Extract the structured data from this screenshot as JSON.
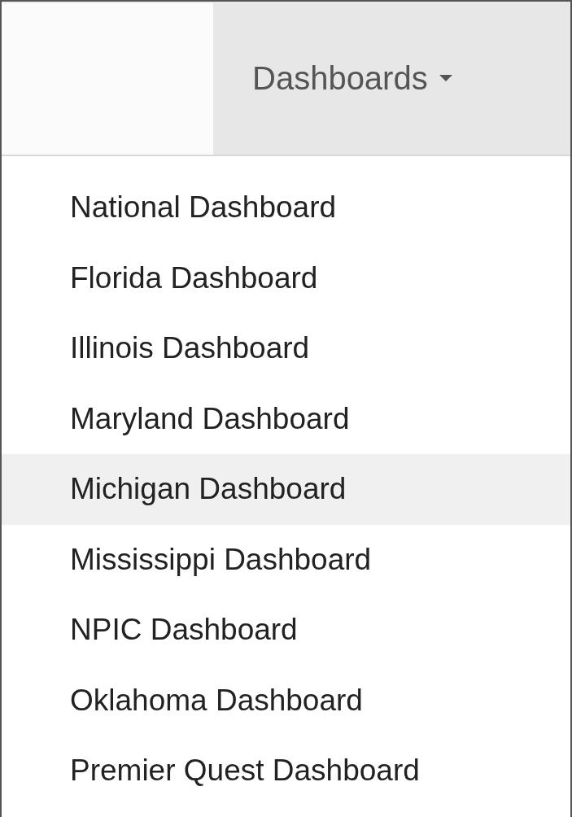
{
  "navbar": {
    "toggle": {
      "label": "Dashboards",
      "expanded": true
    }
  },
  "dropdown": {
    "items": [
      {
        "label": "National Dashboard",
        "selected": false
      },
      {
        "label": "Florida Dashboard",
        "selected": false
      },
      {
        "label": "Illinois Dashboard",
        "selected": false
      },
      {
        "label": "Maryland Dashboard",
        "selected": false
      },
      {
        "label": "Michigan Dashboard",
        "selected": true
      },
      {
        "label": "Mississippi Dashboard",
        "selected": false
      },
      {
        "label": "NPIC Dashboard",
        "selected": false
      },
      {
        "label": "Oklahoma Dashboard",
        "selected": false
      },
      {
        "label": "Premier Quest Dashboard",
        "selected": false
      }
    ]
  }
}
